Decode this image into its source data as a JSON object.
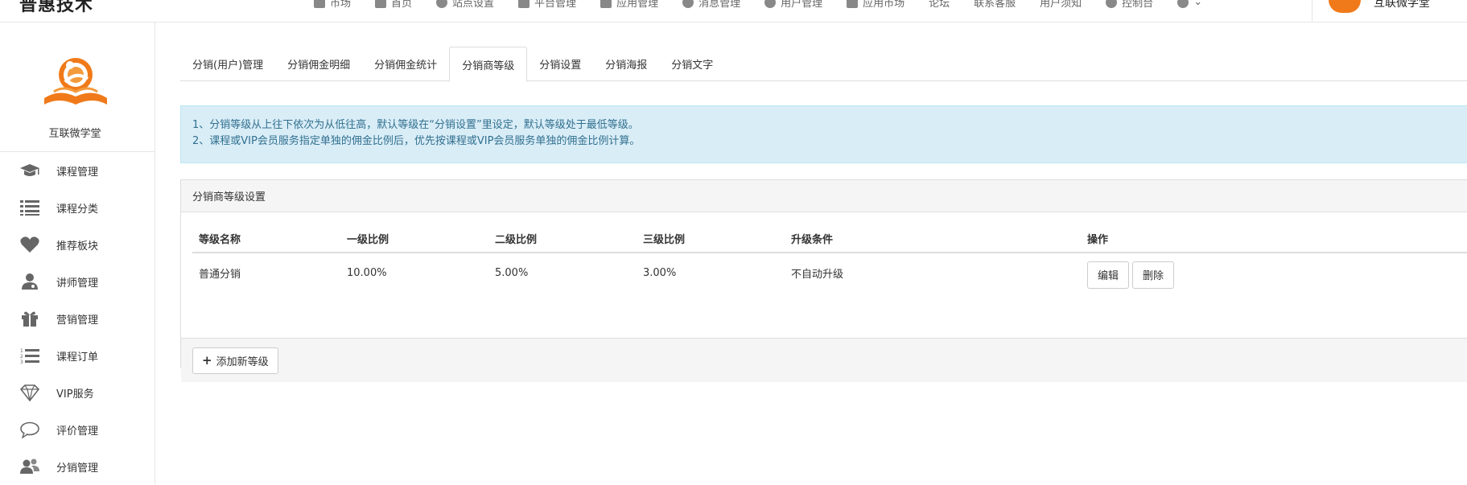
{
  "header": {
    "brand": "普惠技术",
    "nav": [
      {
        "label": "市场",
        "icon": "home-icon"
      },
      {
        "label": "首页",
        "icon": "file-icon"
      },
      {
        "label": "站点设置",
        "icon": "globe-icon"
      },
      {
        "label": "平台管理",
        "icon": "list-icon"
      },
      {
        "label": "应用管理",
        "icon": "cube-icon"
      },
      {
        "label": "消息管理",
        "icon": "bell-icon"
      },
      {
        "label": "用户管理",
        "icon": "users-icon"
      },
      {
        "label": "应用市场",
        "icon": "shop-icon"
      },
      {
        "label": "论坛",
        "icon": ""
      },
      {
        "label": "联系客服",
        "icon": ""
      },
      {
        "label": "用户须知",
        "icon": ""
      },
      {
        "label": "控制台",
        "icon": "dashboard-icon"
      }
    ],
    "user_name": "互联微学堂"
  },
  "sidebar": {
    "site_name": "互联微学堂",
    "items": [
      {
        "label": "课程管理",
        "icon": "graduation-cap-icon"
      },
      {
        "label": "课程分类",
        "icon": "list-icon"
      },
      {
        "label": "推荐板块",
        "icon": "heart-icon"
      },
      {
        "label": "讲师管理",
        "icon": "user-md-icon"
      },
      {
        "label": "营销管理",
        "icon": "gift-icon"
      },
      {
        "label": "课程订单",
        "icon": "ordered-list-icon"
      },
      {
        "label": "VIP服务",
        "icon": "diamond-icon"
      },
      {
        "label": "评价管理",
        "icon": "comment-icon"
      },
      {
        "label": "分销管理",
        "icon": "users-icon"
      }
    ]
  },
  "tabs": [
    {
      "label": "分销(用户)管理",
      "active": false
    },
    {
      "label": "分销佣金明细",
      "active": false
    },
    {
      "label": "分销佣金统计",
      "active": false
    },
    {
      "label": "分销商等级",
      "active": true
    },
    {
      "label": "分销设置",
      "active": false
    },
    {
      "label": "分销海报",
      "active": false
    },
    {
      "label": "分销文字",
      "active": false
    }
  ],
  "notice": {
    "line1": "1、分销等级从上往下依次为从低往高，默认等级在“分销设置”里设定，默认等级处于最低等级。",
    "line2": "2、课程或VIP会员服务指定单独的佣金比例后，优先按课程或VIP会员服务单独的佣金比例计算。"
  },
  "panel": {
    "title": "分销商等级设置",
    "columns": [
      "等级名称",
      "一级比例",
      "二级比例",
      "三级比例",
      "升级条件",
      "操作"
    ],
    "rows": [
      {
        "name": "普通分销",
        "level1": "10.00%",
        "level2": "5.00%",
        "level3": "3.00%",
        "condition": "不自动升级",
        "edit": "编辑",
        "delete": "删除"
      }
    ],
    "add_button": "添加新等级"
  },
  "colors": {
    "accent": "#f07a1a",
    "notice_bg": "#d9edf7",
    "notice_text": "#31708f"
  }
}
